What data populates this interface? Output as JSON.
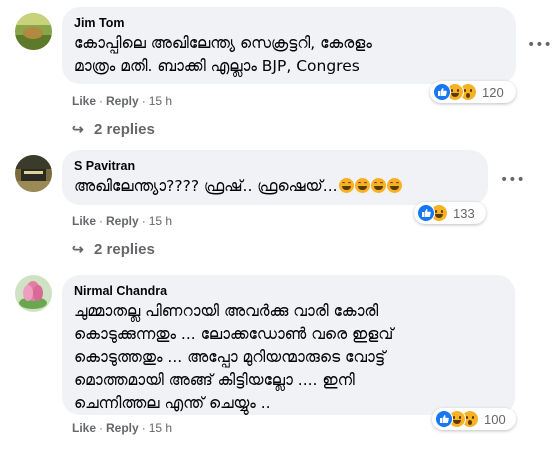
{
  "comments": [
    {
      "author": "Jim Tom",
      "lines": [
        "കോപ്പിലെ അഖിലേന്ത്യ സെക്രട്ടറി, കേരളം",
        "മാത്രം മതി. ബാക്കി എല്ലാം BJP, Congres"
      ],
      "like_label": "Like",
      "reply_label": "Reply",
      "time": "15 h",
      "reaction_count": "120",
      "reaction_icons": [
        "like-icon",
        "haha-icon",
        "wow-icon"
      ],
      "replies_label": "2 replies"
    },
    {
      "author": "S Pavitran",
      "lines": [
        "അഖിലേന്ത്യാ???? ഫ്രഷ്.. ഫ്രഷെയ്..."
      ],
      "inline_emoji": [
        "grinning-squint-emoji",
        "grinning-squint-emoji",
        "grinning-squint-emoji",
        "grinning-squint-emoji"
      ],
      "like_label": "Like",
      "reply_label": "Reply",
      "time": "15 h",
      "reaction_count": "133",
      "reaction_icons": [
        "like-icon",
        "haha-icon"
      ],
      "replies_label": "2 replies"
    },
    {
      "author": "Nirmal Chandra",
      "lines": [
        "ചുമ്മാതല്ല പിണറായി അവർക്കു വാരി കോരി",
        "കൊടുക്കുന്നതും ... ലോക്കഡോൺ വരെ ഇളവ്",
        "കൊടുത്തതും ... അപ്പോ മുറിയന്മാരുടെ വോട്ട്",
        "മൊത്തമായി അങ്ങ് കിട്ടിയല്ലോ .... ഇനി",
        "ചെന്നിത്തല എന്ത് ചെയ്യും .."
      ],
      "like_label": "Like",
      "reply_label": "Reply",
      "time": "15 h",
      "reaction_count": "100",
      "reaction_icons": [
        "like-icon",
        "haha-icon",
        "wow-icon"
      ]
    }
  ],
  "more_icon": "more-options-icon",
  "reply_arrow_icon": "reply-arrow-icon",
  "colors": {
    "bubble": "#f0f2f5",
    "like_blue": "#1877f2",
    "emoji_yellow": "#f7b125",
    "meta_gray": "#65676b"
  }
}
